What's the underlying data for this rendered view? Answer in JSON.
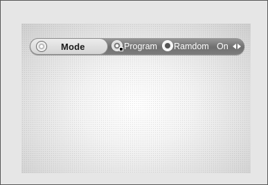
{
  "menu": {
    "mode": {
      "label": "Mode",
      "icon": "mode-disc-icon"
    },
    "program": {
      "label": "Program",
      "icon": "program-icon"
    },
    "random": {
      "label": "Ramdom",
      "icon": "random-icon"
    },
    "value": {
      "label": "On",
      "icon": "left-right-arrows-icon"
    }
  }
}
